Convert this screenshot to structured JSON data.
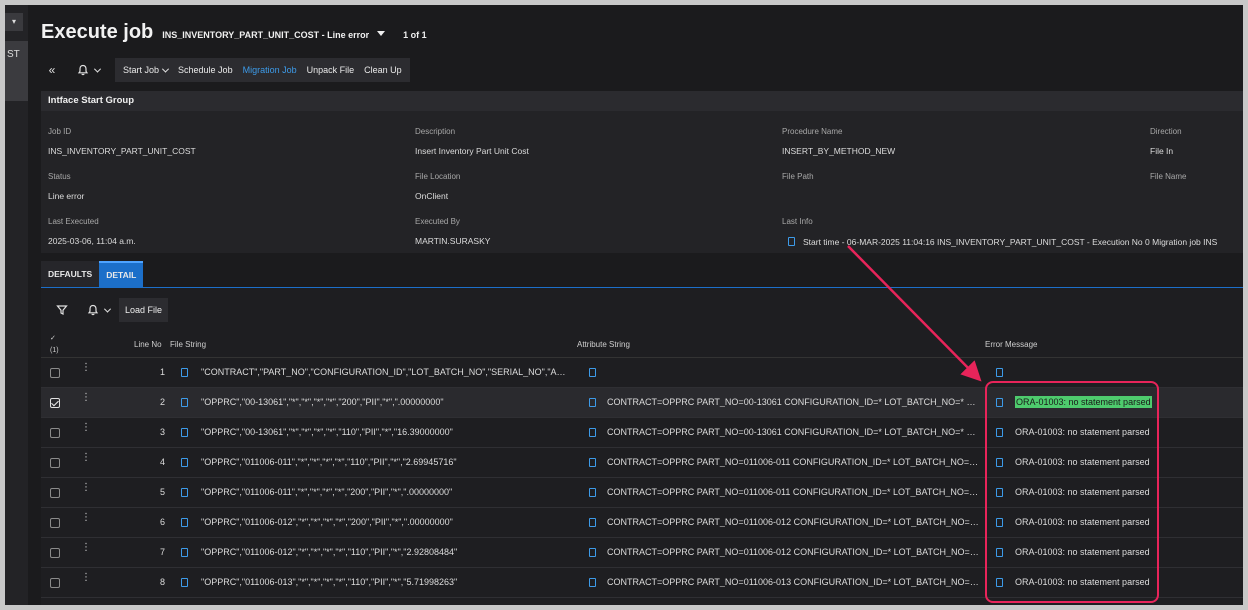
{
  "rail": {
    "top_glyph": "▾",
    "tab_label": "ST"
  },
  "header": {
    "title": "Execute job",
    "job_selector": "INS_INVENTORY_PART_UNIT_COST - Line error",
    "pager": "1 of 1"
  },
  "toolbar": {
    "buttons": {
      "start_job": "Start Job",
      "schedule_job": "Schedule Job",
      "migration_job": "Migration Job",
      "unpack_file": "Unpack File",
      "clean_up": "Clean Up"
    }
  },
  "group": {
    "title": "Intface Start Group",
    "fields": {
      "job_id": {
        "label": "Job ID",
        "value": "INS_INVENTORY_PART_UNIT_COST"
      },
      "description": {
        "label": "Description",
        "value": "Insert Inventory Part Unit Cost"
      },
      "procedure_name": {
        "label": "Procedure Name",
        "value": "INSERT_BY_METHOD_NEW"
      },
      "direction": {
        "label": "Direction",
        "value": "File In"
      },
      "status": {
        "label": "Status",
        "value": "Line error"
      },
      "file_location": {
        "label": "File Location",
        "value": "OnClient"
      },
      "file_path": {
        "label": "File Path",
        "value": ""
      },
      "file_name": {
        "label": "File Name",
        "value": ""
      },
      "last_executed": {
        "label": "Last Executed",
        "value": "2025-03-06, 11:04 a.m."
      },
      "executed_by": {
        "label": "Executed By",
        "value": "MARTIN.SURASKY"
      },
      "last_info": {
        "label": "Last Info",
        "value": "Start time - 06-MAR-2025 11:04:16   INS_INVENTORY_PART_UNIT_COST - Execution No 0 Migration job INS"
      }
    }
  },
  "tabs": {
    "defaults": "DEFAULTS",
    "detail": "DETAIL"
  },
  "detail": {
    "load_file": "Load File",
    "selected_count": "(1)",
    "columns": {
      "line_no": "Line No",
      "file_string": "File String",
      "attribute_string": "Attribute String",
      "error_message": "Error Message"
    },
    "rows": [
      {
        "line_no": "1",
        "file_string": "\"CONTRACT\",\"PART_NO\",\"CONFIGURATION_ID\",\"LOT_BATCH_NO\",\"SERIAL_NO\",\"ACCO...",
        "attribute_string": "",
        "error_message": ""
      },
      {
        "line_no": "2",
        "file_string": "\"OPPRC\",\"00-13061\",\"*\",\"*\",\"*\",\"*\",\"200\",\"PII\",\"*\",\".00000000\"",
        "attribute_string": "CONTRACT=OPPRC PART_NO=00-13061 CONFIGURATION_ID=* LOT_BATCH_NO=* SER...",
        "error_message": "ORA-01003: no statement parsed"
      },
      {
        "line_no": "3",
        "file_string": "\"OPPRC\",\"00-13061\",\"*\",\"*\",\"*\",\"*\",\"110\",\"PII\",\"*\",\"16.39000000\"",
        "attribute_string": "CONTRACT=OPPRC PART_NO=00-13061 CONFIGURATION_ID=* LOT_BATCH_NO=* SER...",
        "error_message": "ORA-01003: no statement parsed"
      },
      {
        "line_no": "4",
        "file_string": "\"OPPRC\",\"011006-011\",\"*\",\"*\",\"*\",\"*\",\"110\",\"PII\",\"*\",\"2.69945716\"",
        "attribute_string": "CONTRACT=OPPRC PART_NO=011006-011 CONFIGURATION_ID=* LOT_BATCH_NO=* S...",
        "error_message": "ORA-01003: no statement parsed"
      },
      {
        "line_no": "5",
        "file_string": "\"OPPRC\",\"011006-011\",\"*\",\"*\",\"*\",\"*\",\"200\",\"PII\",\"*\",\".00000000\"",
        "attribute_string": "CONTRACT=OPPRC PART_NO=011006-011 CONFIGURATION_ID=* LOT_BATCH_NO=* S...",
        "error_message": "ORA-01003: no statement parsed"
      },
      {
        "line_no": "6",
        "file_string": "\"OPPRC\",\"011006-012\",\"*\",\"*\",\"*\",\"*\",\"200\",\"PII\",\"*\",\".00000000\"",
        "attribute_string": "CONTRACT=OPPRC PART_NO=011006-012 CONFIGURATION_ID=* LOT_BATCH_NO=* S...",
        "error_message": "ORA-01003: no statement parsed"
      },
      {
        "line_no": "7",
        "file_string": "\"OPPRC\",\"011006-012\",\"*\",\"*\",\"*\",\"*\",\"110\",\"PII\",\"*\",\"2.92808484\"",
        "attribute_string": "CONTRACT=OPPRC PART_NO=011006-012 CONFIGURATION_ID=* LOT_BATCH_NO=* S...",
        "error_message": "ORA-01003: no statement parsed"
      },
      {
        "line_no": "8",
        "file_string": "\"OPPRC\",\"011006-013\",\"*\",\"*\",\"*\",\"*\",\"110\",\"PII\",\"*\",\"5.71998263\"",
        "attribute_string": "CONTRACT=OPPRC PART_NO=011006-013 CONFIGURATION_ID=* LOT_BATCH_NO=* S...",
        "error_message": "ORA-01003: no statement parsed"
      }
    ]
  },
  "colors": {
    "accent": "#3d9be9",
    "tab_active": "#1c6fc9",
    "highlight": "#4ecb6d",
    "callout": "#e8245a",
    "background": "#1b1b1d"
  }
}
